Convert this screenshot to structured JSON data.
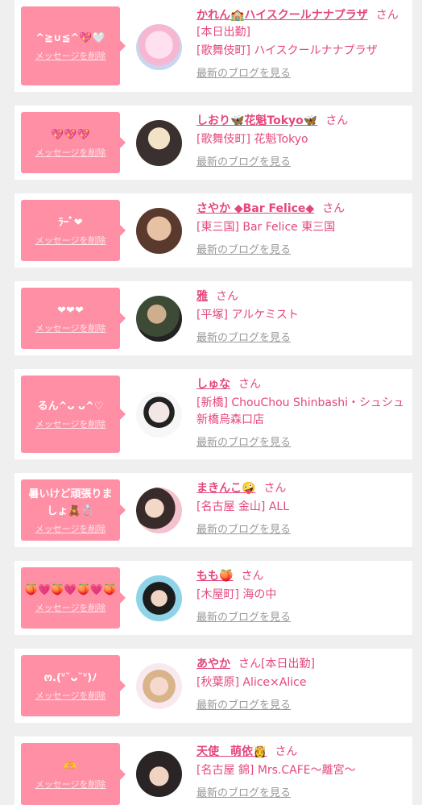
{
  "colors": {
    "background": "#efefef",
    "card": "#ffffff",
    "bubble": "#ff8fa5",
    "accent": "#e4477c",
    "muted": "#999999"
  },
  "items": [
    {
      "message": "^≧∪≦^💖🤍",
      "delete_label": "メッセージを削除",
      "name": "かれん🏫ハイスクールナナプラザ",
      "suffix": "さん",
      "status": "[本日出勤]",
      "shop": "[歌舞伎町] ハイスクールナナプラザ",
      "blog_link": "最新のブログを見る",
      "avatar_icon": "avatar-photo"
    },
    {
      "message": "💖💖💖",
      "delete_label": "メッセージを削除",
      "name": "しおり🦋花魁Tokyo🦋",
      "suffix": "さん",
      "status": "",
      "shop": "[歌舞伎町] 花魁Tokyo",
      "blog_link": "最新のブログを見る",
      "avatar_icon": "avatar-photo"
    },
    {
      "message": "ﾗｰﾞ❤",
      "delete_label": "メッセージを削除",
      "name": "さやか ◆Bar Felice◆",
      "suffix": "さん",
      "status": "",
      "shop": "[東三国] Bar Felice 東三国",
      "blog_link": "最新のブログを見る",
      "avatar_icon": "avatar-photo"
    },
    {
      "message": "❤❤❤",
      "delete_label": "メッセージを削除",
      "name": "雅",
      "suffix": "さん",
      "status": "",
      "shop": "[平塚] アルケミスト",
      "blog_link": "最新のブログを見る",
      "avatar_icon": "avatar-photo"
    },
    {
      "message": "るん^ᴗ ᴗ^♡",
      "delete_label": "メッセージを削除",
      "name": "しゅな",
      "suffix": "さん",
      "status": "",
      "shop": "[新橋] ChouChou Shinbashi・シュシュ新橋烏森口店",
      "blog_link": "最新のブログを見る",
      "avatar_icon": "avatar-photo"
    },
    {
      "message": "暑いけど頑張りましょ🧸💍",
      "delete_label": "メッセージを削除",
      "name": "まきんこ🤪",
      "suffix": "さん",
      "status": "",
      "shop": "[名古屋 金山] ALL",
      "blog_link": "最新のブログを見る",
      "avatar_icon": "avatar-photo"
    },
    {
      "message": "🍑💗🍑💗🍑💗🍑",
      "delete_label": "メッセージを削除",
      "name": "もも🍑",
      "suffix": "さん",
      "status": "",
      "shop": "[木屋町] 海の中",
      "blog_link": "最新のブログを見る",
      "avatar_icon": "avatar-photo"
    },
    {
      "message": "ო.(ᐡ˘ᴗ˘ᐡ)ﾉ",
      "delete_label": "メッセージを削除",
      "name": "あやか",
      "suffix": "さん",
      "status": "[本日出勤]",
      "shop": "[秋葉原] Alice×Alice",
      "blog_link": "最新のブログを見る",
      "avatar_icon": "avatar-photo"
    },
    {
      "message": "🫶",
      "delete_label": "メッセージを削除",
      "name": "天使　萌依👸",
      "suffix": "さん",
      "status": "",
      "shop": "[名古屋 錦] Mrs.CAFE〜離宮〜",
      "blog_link": "最新のブログを見る",
      "avatar_icon": "avatar-photo"
    }
  ]
}
